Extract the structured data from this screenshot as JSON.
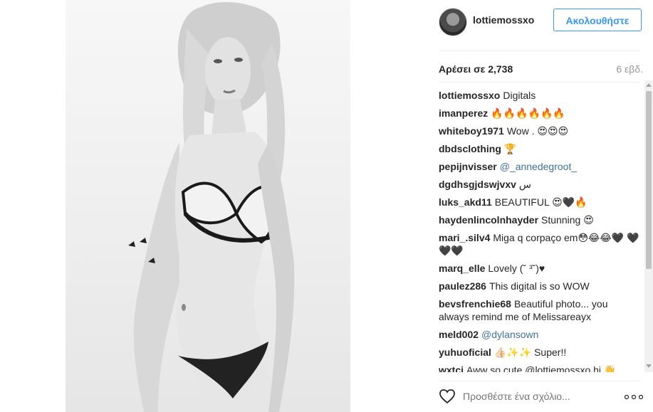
{
  "header": {
    "username": "lottiemossxo",
    "follow_label": "Ακολουθήστε"
  },
  "stats": {
    "likes": "Αρέσει σε 2,738",
    "time_ago": "6 εβδ."
  },
  "comments": [
    {
      "user": "lottiemossxo",
      "text": "Digitals"
    },
    {
      "user": "imanperez",
      "text": "🔥🔥🔥🔥🔥🔥"
    },
    {
      "user": "whiteboy1971",
      "text": "Wow . 😍😍😍"
    },
    {
      "user": "dbdsclothing",
      "text": "🏆"
    },
    {
      "user": "pepijnvisser",
      "text": "@_annedegroot_",
      "mention": true
    },
    {
      "user": "dgdhsgjdswjvxv",
      "text": "س"
    },
    {
      "user": "luks_akd11",
      "text": "BEAUTIFUL 😍🖤🔥"
    },
    {
      "user": "haydenlincolnhayder",
      "text": "Stunning 😍"
    },
    {
      "user": "mari_.silv4",
      "text": "Miga q corpaço em😳😂😂🖤 🖤🖤🖤"
    },
    {
      "user": "marq_elle",
      "text": "Lovely (˘ ³˘)♥"
    },
    {
      "user": "paulez286",
      "text": "This digital is so WOW"
    },
    {
      "user": "bevsfrenchie68",
      "text": "Beautiful photo... you always remind me of Melissareayx"
    },
    {
      "user": "meld002",
      "text": "@dylansown",
      "mention": true
    },
    {
      "user": "yuhuoficial",
      "text": "👍🏻✨✨ Super!!"
    },
    {
      "user": "wxtci",
      "text": "Aww so cute @lottiemossxo hi 👋"
    }
  ],
  "footer": {
    "comment_placeholder": "Προσθέστε ένα σχόλιο..."
  },
  "icons": {
    "like": "heart-icon",
    "more": "more-options-icon"
  },
  "colors": {
    "accent": "#3897f0",
    "mention": "#3f729b",
    "muted": "#999999"
  }
}
